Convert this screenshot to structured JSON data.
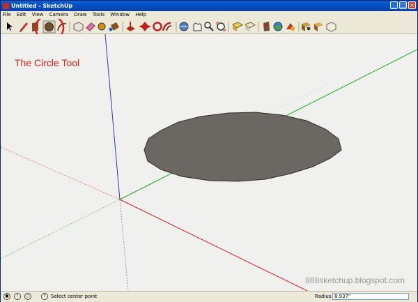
{
  "window": {
    "title": "Untitled - SketchUp"
  },
  "menu": [
    "File",
    "Edit",
    "View",
    "Camera",
    "Draw",
    "Tools",
    "Window",
    "Help"
  ],
  "toolbar": {
    "tools": [
      {
        "name": "select-tool-icon"
      },
      {
        "name": "pencil-tool-icon"
      },
      {
        "name": "rectangle-tool-icon"
      },
      {
        "name": "circle-tool-icon"
      },
      {
        "name": "arc-tool-icon"
      },
      {
        "name": "make-component-icon"
      },
      {
        "name": "eraser-tool-icon"
      },
      {
        "name": "tape-measure-icon"
      },
      {
        "name": "paint-bucket-icon"
      },
      {
        "name": "push-pull-icon"
      },
      {
        "name": "move-tool-icon"
      },
      {
        "name": "rotate-tool-icon"
      },
      {
        "name": "offset-tool-icon"
      },
      {
        "name": "orbit-tool-icon"
      },
      {
        "name": "pan-tool-icon"
      },
      {
        "name": "zoom-tool-icon"
      },
      {
        "name": "zoom-extents-icon"
      },
      {
        "name": "get-models-icon"
      },
      {
        "name": "share-model-icon"
      },
      {
        "name": "add-location-icon"
      },
      {
        "name": "toggle-terrain-icon"
      },
      {
        "name": "photo-textures-icon"
      },
      {
        "name": "get-current-view-icon"
      },
      {
        "name": "warehouse-share-icon"
      },
      {
        "name": "component-icon"
      }
    ]
  },
  "viewport": {
    "annotation": "The Circle Tool",
    "watermark": "888sketchup.blogspot.com",
    "colors": {
      "circle_fill": "#6b6762",
      "red_axis": "#d41f1f",
      "green_axis": "#21a821",
      "blue_axis": "#3535b0",
      "highlight_ring": "#e0201a"
    }
  },
  "status": {
    "text": "Select center point",
    "radius_label": "Radius",
    "radius_value": "8.937\""
  }
}
